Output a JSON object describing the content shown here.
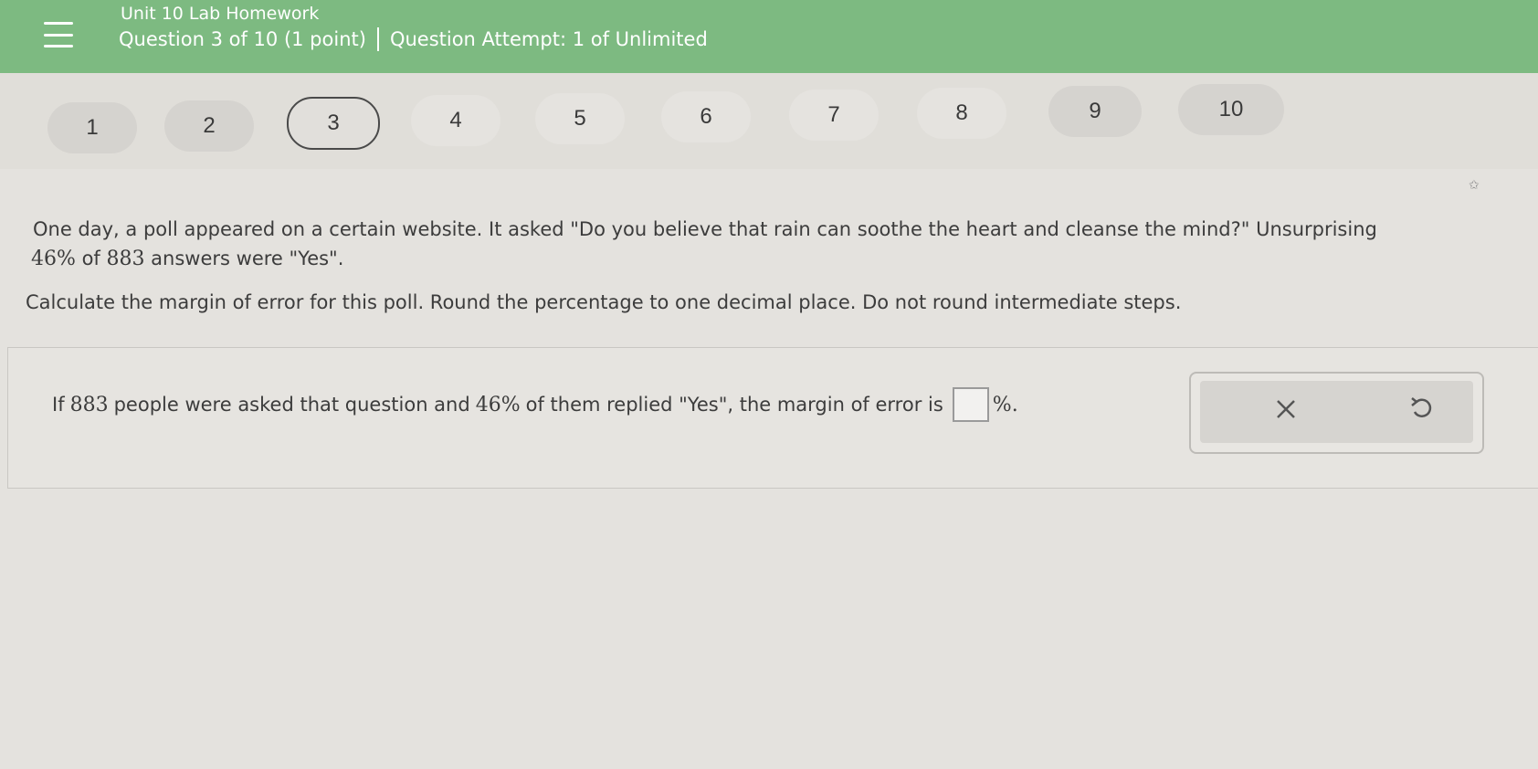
{
  "header": {
    "title": "Unit 10 Lab Homework",
    "question_info": "Question 3 of 10 (1 point)",
    "attempt_info": "Question Attempt: 1 of Unlimited"
  },
  "question_nav": {
    "current": "3",
    "items": [
      "1",
      "2",
      "3",
      "4",
      "5",
      "6",
      "7",
      "8",
      "9",
      "10"
    ]
  },
  "question": {
    "line1": "One day, a poll appeared on a certain website. It asked \"Do you believe that rain can soothe the heart and cleanse the mind?\" Unsurprising",
    "line2_pct": "46%",
    "line2_mid": " of ",
    "line2_n": "883",
    "line2_end": " answers were \"Yes\".",
    "instruction": "Calculate the margin of error for this poll. Round the percentage to one decimal place. Do not round intermediate steps."
  },
  "answer": {
    "prefix": "If ",
    "n": "883",
    "mid": " people were asked that question and ",
    "pct": "46%",
    "suffix": " of them replied \"Yes\", the margin of error is",
    "unit": "%."
  },
  "tools": {
    "clear_icon": "close-icon",
    "undo_icon": "undo-icon"
  },
  "colors": {
    "header_bg": "#7dba81",
    "page_bg": "#e4e2de"
  }
}
